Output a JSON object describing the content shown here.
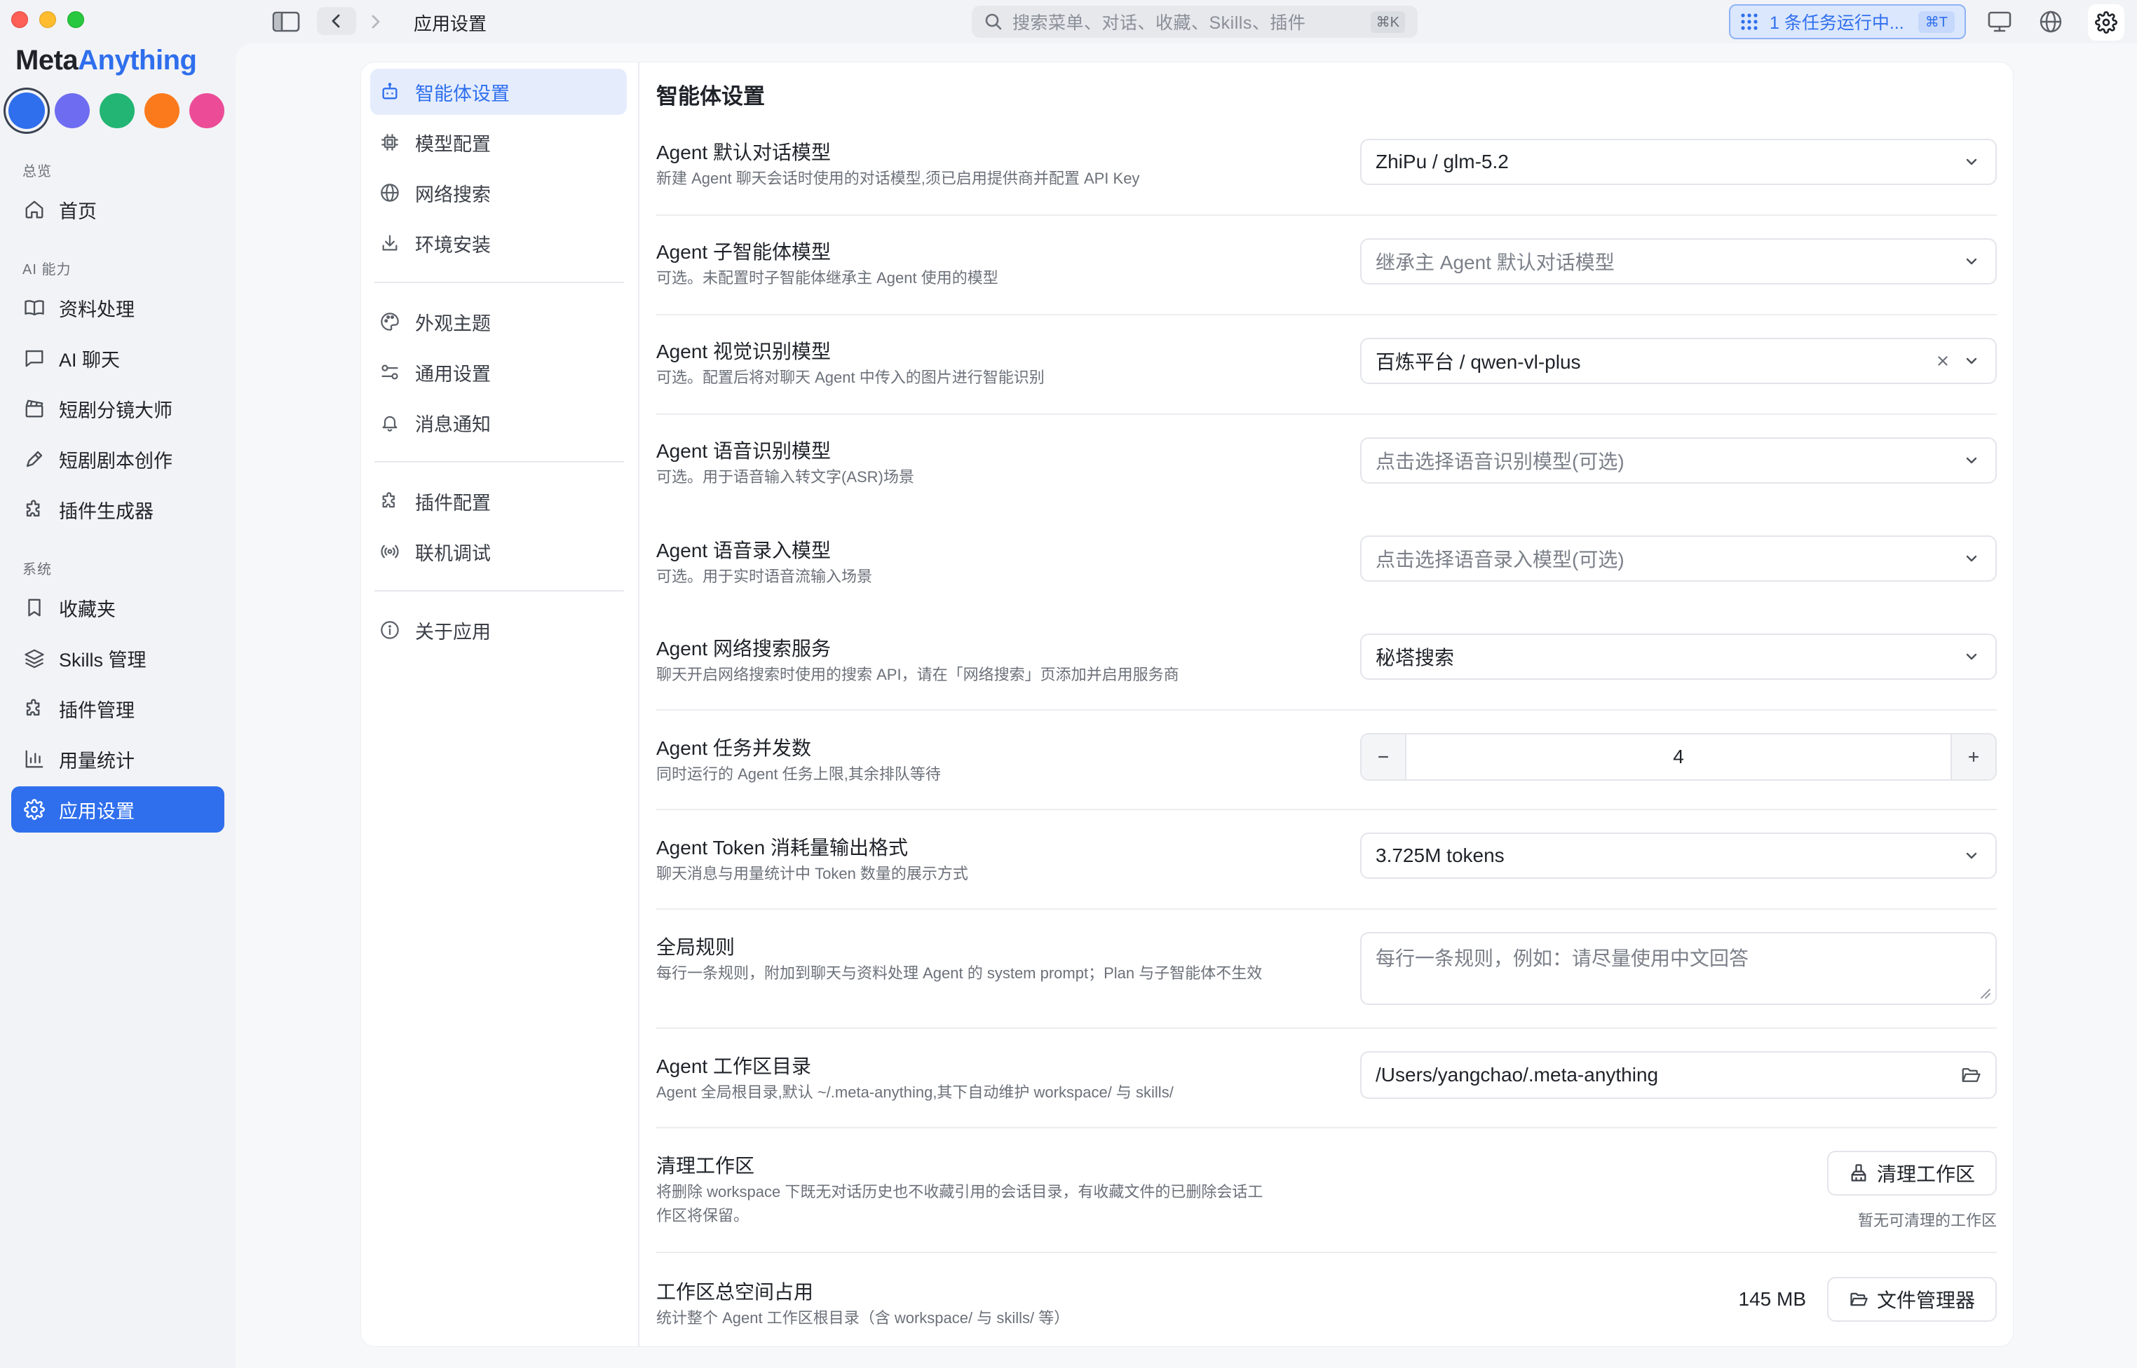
{
  "titlebar": {
    "page_title": "应用设置",
    "search_placeholder": "搜索菜单、对话、收藏、Skills、插件",
    "search_shortcut": "⌘K",
    "task_status": "1 条任务运行中...",
    "task_shortcut": "⌘T"
  },
  "brand": {
    "part1": "Meta",
    "part2": "Anything"
  },
  "theme_colors": [
    "#2f6fed",
    "#6e6cf0",
    "#22b573",
    "#fa7a1c",
    "#ec4c97"
  ],
  "sidebar": {
    "sections": [
      {
        "title": "总览",
        "items": [
          {
            "label": "首页",
            "icon": "home-icon"
          }
        ]
      },
      {
        "title": "AI 能力",
        "items": [
          {
            "label": "资料处理",
            "icon": "book-icon"
          },
          {
            "label": "AI 聊天",
            "icon": "chat-icon"
          },
          {
            "label": "短剧分镜大师",
            "icon": "clapperboard-icon"
          },
          {
            "label": "短剧剧本创作",
            "icon": "pen-icon"
          },
          {
            "label": "插件生成器",
            "icon": "puzzle-icon"
          }
        ]
      },
      {
        "title": "系统",
        "items": [
          {
            "label": "收藏夹",
            "icon": "bookmark-icon"
          },
          {
            "label": "Skills 管理",
            "icon": "layers-icon"
          },
          {
            "label": "插件管理",
            "icon": "puzzle-icon"
          },
          {
            "label": "用量统计",
            "icon": "bar-chart-icon"
          },
          {
            "label": "应用设置",
            "icon": "gear-icon",
            "active": true
          }
        ]
      }
    ]
  },
  "settings_nav": {
    "group1": [
      {
        "label": "智能体设置",
        "icon": "robot-icon",
        "active": true
      },
      {
        "label": "模型配置",
        "icon": "chip-icon"
      },
      {
        "label": "网络搜索",
        "icon": "globe-icon"
      },
      {
        "label": "环境安装",
        "icon": "download-icon"
      }
    ],
    "group2": [
      {
        "label": "外观主题",
        "icon": "palette-icon"
      },
      {
        "label": "通用设置",
        "icon": "sliders-icon"
      },
      {
        "label": "消息通知",
        "icon": "bell-icon"
      }
    ],
    "group3": [
      {
        "label": "插件配置",
        "icon": "puzzle-icon"
      },
      {
        "label": "联机调试",
        "icon": "broadcast-icon"
      }
    ],
    "group4": [
      {
        "label": "关于应用",
        "icon": "info-icon"
      }
    ]
  },
  "agent_settings": {
    "title": "智能体设置",
    "default_model": {
      "label": "Agent 默认对话模型",
      "desc": "新建 Agent 聊天会话时使用的对话模型,须已启用提供商并配置 API Key",
      "value": "ZhiPu / glm-5.2"
    },
    "sub_agent_model": {
      "label": "Agent 子智能体模型",
      "desc": "可选。未配置时子智能体继承主 Agent 使用的模型",
      "placeholder": "继承主 Agent 默认对话模型"
    },
    "vision_model": {
      "label": "Agent 视觉识别模型",
      "desc": "可选。配置后将对聊天 Agent 中传入的图片进行智能识别",
      "value": "百炼平台 / qwen-vl-plus"
    },
    "asr_model": {
      "label": "Agent 语音识别模型",
      "desc": "可选。用于语音输入转文字(ASR)场景",
      "placeholder": "点击选择语音识别模型(可选)"
    },
    "voice_input_model": {
      "label": "Agent 语音录入模型",
      "desc": "可选。用于实时语音流输入场景",
      "placeholder": "点击选择语音录入模型(可选)"
    },
    "web_search_service": {
      "label": "Agent 网络搜索服务",
      "desc": "聊天开启网络搜索时使用的搜索 API，请在「网络搜索」页添加并启用服务商",
      "value": "秘塔搜索"
    },
    "concurrency": {
      "label": "Agent 任务并发数",
      "desc": "同时运行的 Agent 任务上限,其余排队等待",
      "value": "4"
    },
    "token_format": {
      "label": "Agent Token 消耗量输出格式",
      "desc": "聊天消息与用量统计中 Token 数量的展示方式",
      "value": "3.725M tokens"
    },
    "global_rules": {
      "label": "全局规则",
      "desc": "每行一条规则，附加到聊天与资料处理 Agent 的 system prompt；Plan 与子智能体不生效",
      "placeholder": "每行一条规则，例如：请尽量使用中文回答"
    },
    "workspace_dir": {
      "label": "Agent 工作区目录",
      "desc": "Agent 全局根目录,默认 ~/.meta-anything,其下自动维护 workspace/ 与 skills/",
      "value": "/Users/yangchao/.meta-anything"
    },
    "clean_workspace": {
      "label": "清理工作区",
      "desc_line1": "将删除 workspace 下既无对话历史也不收藏引用的会话目录，有收藏文件的已删除会话工",
      "desc_line2": "作区将保留。",
      "button": "清理工作区",
      "hint": "暂无可清理的工作区"
    },
    "workspace_size": {
      "label": "工作区总空间占用",
      "desc": "统计整个 Agent 工作区根目录（含 workspace/ 与 skills/ 等）",
      "value": "145 MB",
      "button": "文件管理器"
    }
  }
}
